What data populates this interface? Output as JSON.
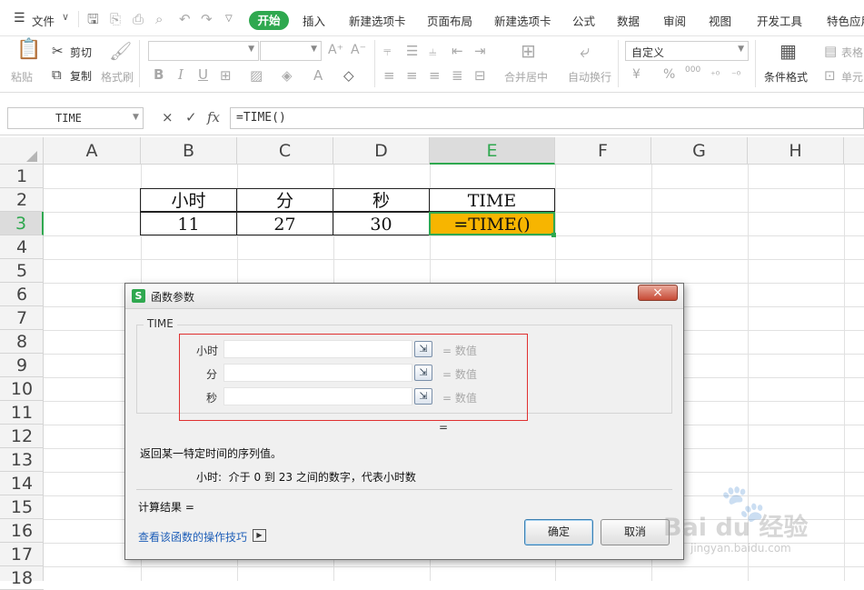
{
  "menubar": {
    "file": "文件",
    "tabs": [
      "开始",
      "插入",
      "新建选项卡",
      "页面布局",
      "新建选项卡",
      "公式",
      "数据",
      "审阅",
      "视图",
      "开发工具",
      "特色应用"
    ]
  },
  "ribbon": {
    "paste": "粘贴",
    "cut": "剪切",
    "copy": "复制",
    "format_painter": "格式刷",
    "bold": "B",
    "italic": "I",
    "underline": "U",
    "font_grow": "A⁺",
    "font_shrink": "A⁻",
    "merge_center": "合并居中",
    "wrap_text": "自动换行",
    "number_format": "自定义",
    "currency": "¥",
    "percent": "%",
    "thousands": "000",
    "cond_format": "条件格式",
    "table_style": "表格",
    "cell": "单元"
  },
  "formula_bar": {
    "name_box": "TIME",
    "cancel": "×",
    "confirm": "✓",
    "fx": "fx",
    "formula": "=TIME()"
  },
  "sheet": {
    "columns": [
      "A",
      "B",
      "C",
      "D",
      "E",
      "F",
      "G",
      "H"
    ],
    "rows": [
      "1",
      "2",
      "3",
      "4",
      "5",
      "6",
      "7",
      "8",
      "9",
      "10",
      "11",
      "12",
      "13",
      "14",
      "15",
      "16",
      "17",
      "18"
    ],
    "table_headers": [
      "小时",
      "分",
      "秒",
      "TIME"
    ],
    "table_values": [
      "11",
      "27",
      "30",
      "=TIME()"
    ],
    "active_cell_color": "#f7b500"
  },
  "dialog": {
    "title": "函数参数",
    "function_name": "TIME",
    "args": [
      {
        "label": "小时",
        "value": "",
        "result": "= 数值"
      },
      {
        "label": "分",
        "value": "",
        "result": "= 数值"
      },
      {
        "label": "秒",
        "value": "",
        "result": "= 数值"
      }
    ],
    "equals": "=",
    "description": "返回某一特定时间的序列值。",
    "arg_help": "小时:  介于 0 到 23 之间的数字，代表小时数",
    "calc_result": "计算结果 =",
    "help_link": "查看该函数的操作技巧",
    "ok": "确定",
    "cancel": "取消",
    "close": "×"
  },
  "watermark": {
    "text": "Bai du 经验",
    "url": "jingyan.baidu.com"
  },
  "colors": {
    "accent": "#2fa84f",
    "highlight_border": "#e03030",
    "link": "#1f5fb8"
  }
}
